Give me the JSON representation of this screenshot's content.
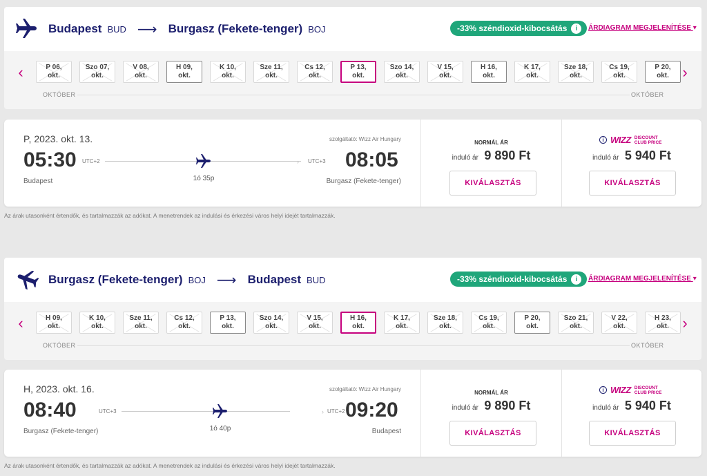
{
  "colors": {
    "accent": "#c6007e",
    "brand": "#1c1f6e",
    "co2": "#1fa67a"
  },
  "outbound": {
    "origin_city": "Budapest",
    "origin_code": "BUD",
    "dest_city": "Burgasz (Fekete-tenger)",
    "dest_code": "BOJ",
    "co2_badge": "-33% széndioxid-kibocsátás",
    "chart_link": "ÁRDIAGRAM MEGJELENÍTÉSE",
    "month_left": "OKTÓBER",
    "month_right": "OKTÓBER",
    "dates": [
      {
        "line1": "P 06,",
        "line2": "okt.",
        "state": "unavailable"
      },
      {
        "line1": "Szo 07,",
        "line2": "okt.",
        "state": "unavailable"
      },
      {
        "line1": "V 08,",
        "line2": "okt.",
        "state": "unavailable"
      },
      {
        "line1": "H 09,",
        "line2": "okt.",
        "state": "available"
      },
      {
        "line1": "K 10,",
        "line2": "okt.",
        "state": "unavailable"
      },
      {
        "line1": "Sze 11,",
        "line2": "okt.",
        "state": "unavailable"
      },
      {
        "line1": "Cs 12,",
        "line2": "okt.",
        "state": "unavailable"
      },
      {
        "line1": "P 13,",
        "line2": "okt.",
        "state": "selected"
      },
      {
        "line1": "Szo 14,",
        "line2": "okt.",
        "state": "unavailable"
      },
      {
        "line1": "V 15,",
        "line2": "okt.",
        "state": "unavailable"
      },
      {
        "line1": "H 16,",
        "line2": "okt.",
        "state": "available"
      },
      {
        "line1": "K 17,",
        "line2": "okt.",
        "state": "unavailable"
      },
      {
        "line1": "Sze 18,",
        "line2": "okt.",
        "state": "unavailable"
      },
      {
        "line1": "Cs 19,",
        "line2": "okt.",
        "state": "unavailable"
      },
      {
        "line1": "P 20,",
        "line2": "okt.",
        "state": "available"
      }
    ],
    "flight": {
      "date": "P, 2023. okt. 13.",
      "operator": "szolgáltató: Wizz Air Hungary",
      "dep_time": "05:30",
      "dep_utc": "UTC+2",
      "arr_time": "08:05",
      "arr_utc": "UTC+3",
      "duration": "1ó 35p",
      "dep_city": "Budapest",
      "arr_city": "Burgasz (Fekete-tenger)",
      "normal_label": "NORMÁL ÁR",
      "from_label": "induló ár",
      "normal_price": "9 890 Ft",
      "club_logo": "WIZZ",
      "club_line1": "DISCOUNT",
      "club_line2": "CLUB PRICE",
      "club_price": "5 940 Ft",
      "select_label": "KIVÁLASZTÁS"
    },
    "footnote": "Az árak utasonként értendők, és tartalmazzák az adókat. A menetrendek az indulási és érkezési város helyi idejét tartalmazzák."
  },
  "inbound": {
    "origin_city": "Burgasz (Fekete-tenger)",
    "origin_code": "BOJ",
    "dest_city": "Budapest",
    "dest_code": "BUD",
    "co2_badge": "-33% széndioxid-kibocsátás",
    "chart_link": "ÁRDIAGRAM MEGJELENÍTÉSE",
    "month_left": "OKTÓBER",
    "month_right": "OKTÓBER",
    "dates": [
      {
        "line1": "H 09,",
        "line2": "okt.",
        "state": "unavailable"
      },
      {
        "line1": "K 10,",
        "line2": "okt.",
        "state": "unavailable"
      },
      {
        "line1": "Sze 11,",
        "line2": "okt.",
        "state": "unavailable"
      },
      {
        "line1": "Cs 12,",
        "line2": "okt.",
        "state": "unavailable"
      },
      {
        "line1": "P 13,",
        "line2": "okt.",
        "state": "available"
      },
      {
        "line1": "Szo 14,",
        "line2": "okt.",
        "state": "unavailable"
      },
      {
        "line1": "V 15,",
        "line2": "okt.",
        "state": "unavailable"
      },
      {
        "line1": "H 16,",
        "line2": "okt.",
        "state": "selected"
      },
      {
        "line1": "K 17,",
        "line2": "okt.",
        "state": "unavailable"
      },
      {
        "line1": "Sze 18,",
        "line2": "okt.",
        "state": "unavailable"
      },
      {
        "line1": "Cs 19,",
        "line2": "okt.",
        "state": "unavailable"
      },
      {
        "line1": "P 20,",
        "line2": "okt.",
        "state": "available"
      },
      {
        "line1": "Szo 21,",
        "line2": "okt.",
        "state": "unavailable"
      },
      {
        "line1": "V 22,",
        "line2": "okt.",
        "state": "unavailable"
      },
      {
        "line1": "H 23,",
        "line2": "okt.",
        "state": "unavailable"
      }
    ],
    "flight": {
      "date": "H, 2023. okt. 16.",
      "operator": "szolgáltató: Wizz Air Hungary",
      "dep_time": "08:40",
      "dep_utc": "UTC+3",
      "arr_time": "09:20",
      "arr_utc": "UTC+2",
      "duration": "1ó 40p",
      "dep_city": "Burgasz (Fekete-tenger)",
      "arr_city": "Budapest",
      "normal_label": "NORMÁL ÁR",
      "from_label": "induló ár",
      "normal_price": "9 890 Ft",
      "club_logo": "WIZZ",
      "club_line1": "DISCOUNT",
      "club_line2": "CLUB PRICE",
      "club_price": "5 940 Ft",
      "select_label": "KIVÁLASZTÁS"
    },
    "footnote": "Az árak utasonként értendők, és tartalmazzák az adókat. A menetrendek az indulási és érkezési város helyi idejét tartalmazzák."
  }
}
